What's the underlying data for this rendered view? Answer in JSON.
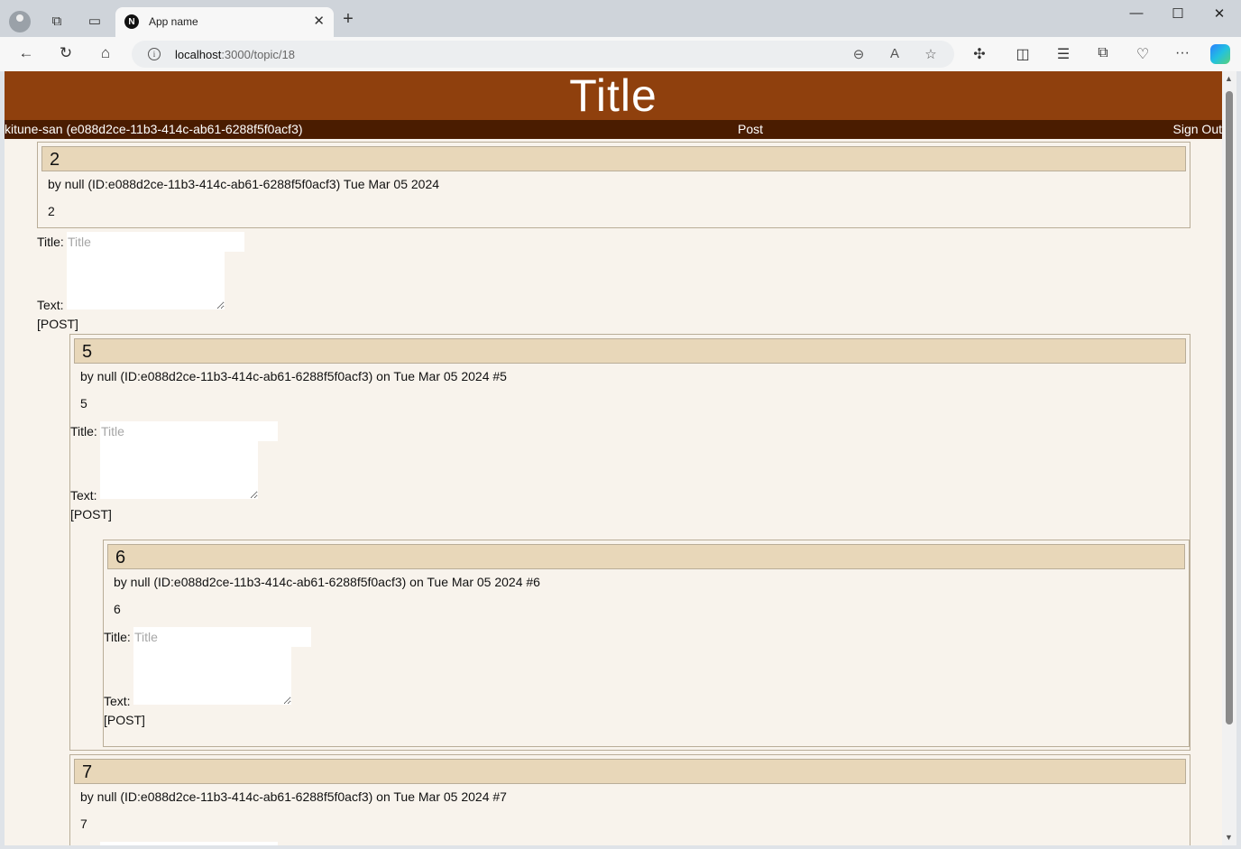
{
  "browser": {
    "tab_title": "App name",
    "tab_favicon": "N",
    "url_host": "localhost",
    "url_path": ":3000/topic/18"
  },
  "site": {
    "title": "Title",
    "nav": {
      "user": "kitune-san (e088d2ce-11b3-414c-ab61-6288f5f0acf3)",
      "post": "Post",
      "sign_out": "Sign Out"
    }
  },
  "topic": {
    "title": "2",
    "meta": "by null (ID:e088d2ce-11b3-414c-ab61-6288f5f0acf3) Tue Mar 05 2024",
    "body": "2"
  },
  "form": {
    "title_label": "Title:",
    "title_placeholder": "Title",
    "text_label": "Text:",
    "post_button": "[POST]"
  },
  "replies": [
    {
      "title": "5",
      "meta": "by null (ID:e088d2ce-11b3-414c-ab61-6288f5f0acf3) on Tue Mar 05 2024 #5",
      "body": "5"
    },
    {
      "title": "6",
      "meta": "by null (ID:e088d2ce-11b3-414c-ab61-6288f5f0acf3) on Tue Mar 05 2024 #6",
      "body": "6"
    },
    {
      "title": "7",
      "meta": "by null (ID:e088d2ce-11b3-414c-ab61-6288f5f0acf3) on Tue Mar 05 2024 #7",
      "body": "7"
    }
  ],
  "colors": {
    "header_bg": "#8f400d",
    "nav_bg": "#4a1c00",
    "page_bg": "#f8f3ec",
    "post_title_bg": "#e8d7b9"
  }
}
